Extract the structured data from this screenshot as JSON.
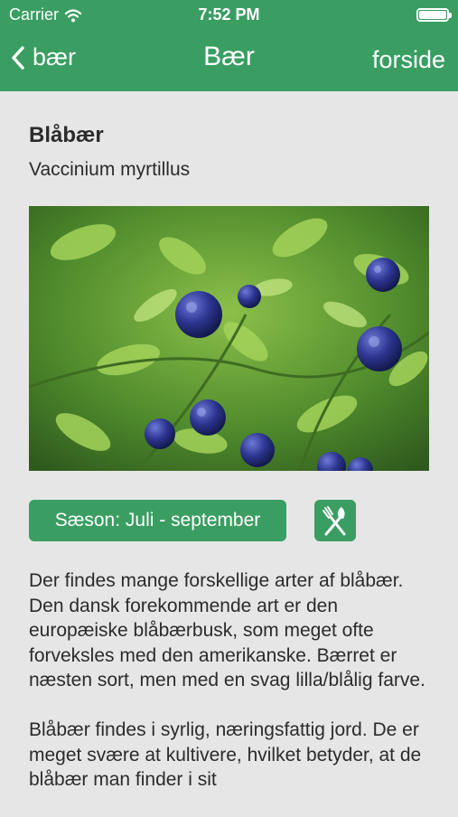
{
  "status_bar": {
    "carrier": "Carrier",
    "time": "7:52 PM"
  },
  "nav": {
    "back_label": "bær",
    "title": "Bær",
    "right_label": "forside"
  },
  "berry": {
    "name": "Blåbær",
    "latin_name": "Vaccinium myrtillus",
    "season": "Sæson: Juli - september",
    "description": [
      "Der findes mange forskellige arter af blåbær. Den dansk forekommende art er den europæiske blåbærbusk, som meget ofte forveksles med den amerikanske. Bærret er næsten sort, men med en svag lilla/blålig farve.",
      "Blåbær findes i syrlig, næringsfattig jord. De er meget svære at kultivere, hvilket betyder, at de blåbær man finder i sit"
    ]
  },
  "icons": {
    "back": "chevron-left-icon",
    "wifi": "wifi-icon",
    "battery": "battery-icon",
    "recipe": "fork-knife-icon"
  },
  "colors": {
    "accent": "#3a9e63",
    "background": "#e6e6e6"
  }
}
